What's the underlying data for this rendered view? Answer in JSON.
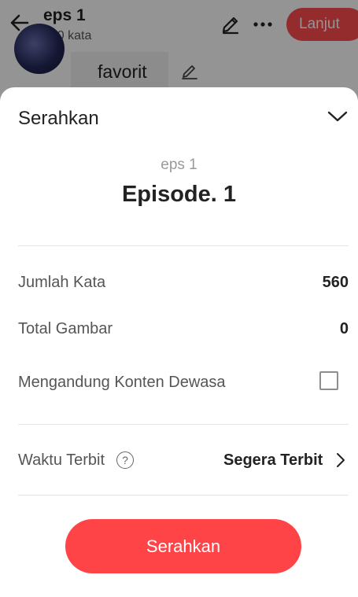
{
  "header": {
    "title": "eps 1",
    "subtitle": "560 kata",
    "continue_label": "Lanjut",
    "back_icon": "arrow-left-icon",
    "edit_icon": "pen-icon",
    "more_icon": "more-horizontal-icon"
  },
  "background": {
    "tag_label": "favorit"
  },
  "sheet": {
    "title": "Serahkan",
    "episode_label": "eps 1",
    "episode_title": "Episode. 1",
    "rows": {
      "word_count_label": "Jumlah Kata",
      "word_count_value": "560",
      "image_count_label": "Total Gambar",
      "image_count_value": "0",
      "adult_content_label": "Mengandung Konten Dewasa",
      "adult_content_checked": false,
      "publish_time_label": "Waktu Terbit",
      "publish_time_value": "Segera Terbit"
    },
    "submit_label": "Serahkan"
  },
  "colors": {
    "accent": "#ff4448",
    "overlay": "rgba(0,0,0,0.42)"
  }
}
